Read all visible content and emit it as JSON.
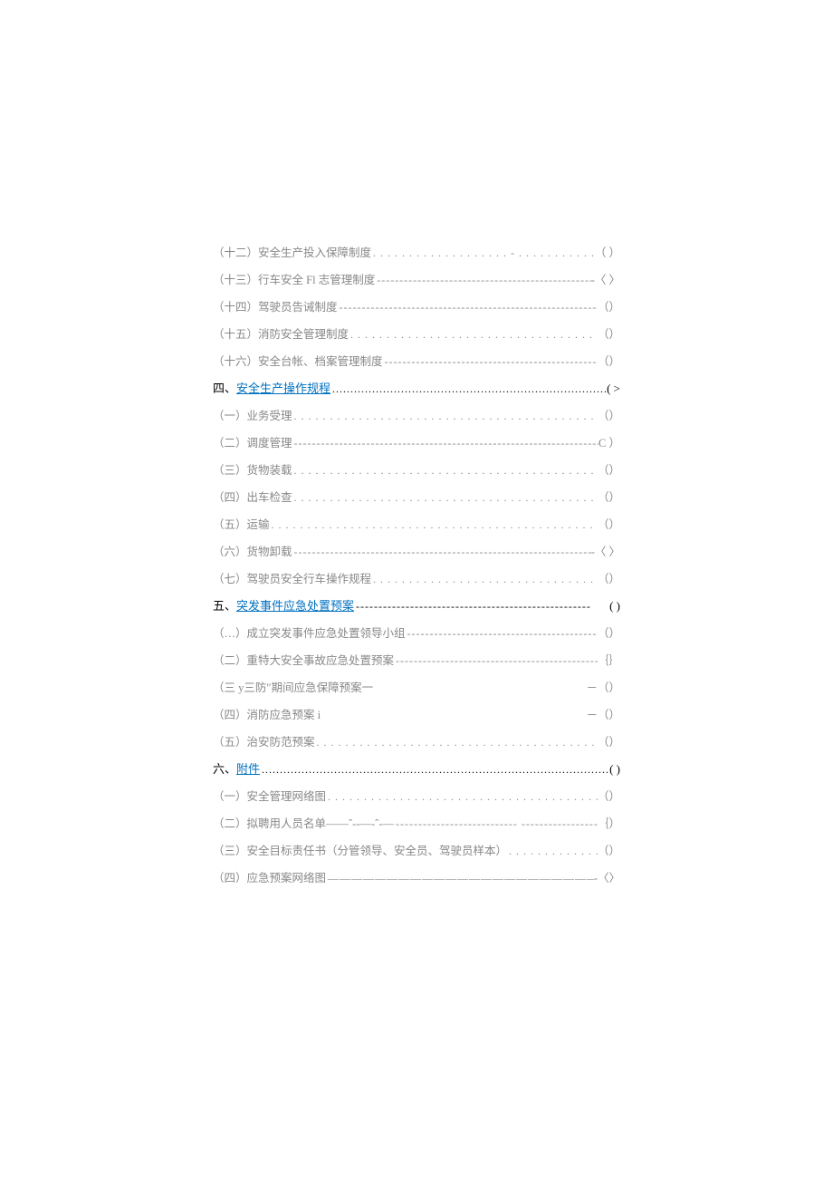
{
  "toc": [
    {
      "prefix": "（十二）",
      "text": "安全生产投入保障制度",
      "leader": ". . . . . . . . . . . . . . . . . . .  -  . . . . . . . . . . . . . . . . . . . . . ——",
      "page": "（ ）",
      "type": "sub"
    },
    {
      "prefix": "（十三）",
      "text": "行车安全 Fl 志管理制度",
      "leader": " ------------------------------------------------------------",
      "page": "-〈  〉",
      "type": "sub"
    },
    {
      "prefix": "（十四）",
      "text": "驾驶员告诫制度",
      "leader": " ---------------------------------------------------------------------- ",
      "page": "（）",
      "type": "sub"
    },
    {
      "prefix": "（十五）",
      "text": "消防安全管理制度 ",
      "leader": ". . . . . . . . . . . . . . . . . . . . . . . . . . . . . . . . . . . . . . . . . . . . . .",
      "page": "（）",
      "type": "sub"
    },
    {
      "prefix": "（十六）",
      "text": "安全台帐、档案管理制度 ",
      "leader": "-------------------------------------------------- ",
      "page": "（）",
      "type": "sub"
    },
    {
      "prefix": "四、",
      "text": "安全生产操作规程",
      "leader": "..........................................................................................................",
      "page": " ( >",
      "type": "header",
      "link": true
    },
    {
      "prefix": "（一）",
      "text": "业务受理 ",
      "leader": ". . . . . . . . . . . . . . . . . . . . . . . . . . . . . . . . . . . . . . . . . . . . . . . . . . . . . . ",
      "page": "（）",
      "type": "sub"
    },
    {
      "prefix": "（二）",
      "text": "调度管理 ",
      "leader": "----------------------------------------------------------------------------------",
      "page": "C  ）",
      "type": "sub"
    },
    {
      "prefix": "（三）",
      "text": "货物装载 ",
      "leader": ". . . . . . . . . . . . . . . . . . . . . . . . . . . . . . . . . . . . . . . . . . . . . . . . . . . . . . ",
      "page": "（）",
      "type": "sub"
    },
    {
      "prefix": "（四）",
      "text": "出车检查 ",
      "leader": ". . . . . . . . . . . . . . . . . . . . . . . . . . . . . . . . . . . . . . . . . . . . . . . . . . . . . . ",
      "page": "（）",
      "type": "sub"
    },
    {
      "prefix": "（五）",
      "text": "运输 ",
      "leader": ". . . . . . . . . . . . . . . . . . . . . . . . . . . . . . . . . . . . . . . . . . . . . . . . . . . . . . . . . . ",
      "page": "（）",
      "type": "sub"
    },
    {
      "prefix": "（六）",
      "text": "货物卸载 ",
      "leader": "----------------------------------------------------------------------------------",
      "page": "-〈  〉",
      "type": "sub"
    },
    {
      "prefix": "（七）",
      "text": "驾驶员安全行车操作规程 ",
      "leader": ". . . . . . . . . . . . . . . . . . . . . . . . . . . . . . . . . . . . . . . . ",
      "page": "（）",
      "type": "sub"
    },
    {
      "prefix": "五、",
      "text": "突发事件应急处置预案",
      "leader": " ----------------------------------------------------",
      "page": " ( )",
      "type": "header",
      "link": true
    },
    {
      "prefix": "（…）",
      "text": "成立突发事件应急处置领导小组 ",
      "leader": "------------------------------------------- ",
      "page": "（）",
      "type": "sub"
    },
    {
      "prefix": "（二）",
      "text": "重特大安全事故应急处置预案 ",
      "leader": "----------------------------------------------- ",
      "page": "｛｝",
      "type": "sub"
    },
    {
      "prefix": "（三 y",
      "text": " 三防″期间应急保障预案一",
      "leader": "                                                            ",
      "page": "－（）",
      "type": "sub"
    },
    {
      "prefix": "（四）",
      "text": "消防应急预案 i",
      "leader": "                                                                      ",
      "page": "－（）",
      "type": "sub"
    },
    {
      "prefix": "（五）",
      "text": "治安防范预案 ",
      "leader": ". . . . . . . . . . . . . . . . . . . . . . . . . . . . . . . . . . . . . . . . . . . . . . . . . ",
      "page": "（）",
      "type": "sub"
    },
    {
      "prefix": "六、",
      "text": "附件",
      "leader": "........................................................................................................................................",
      "page": " ( )",
      "type": "header",
      "link": true
    },
    {
      "prefix": "（一）",
      "text": "安全管理网络图 ",
      "leader": ". . . . . . . . . . . . . . . . . . . . . . . . . . . . . . . . . . . . . . . . . . . . . . . ",
      "page": "（）",
      "type": "sub"
    },
    {
      "prefix": "（二）",
      "text": "拟聘用人员名单——ˆ--—-ˆ-— ",
      "leader": "---------------------------   ------------------------------ ",
      "page": "｛）",
      "type": "sub"
    },
    {
      "prefix": "（三）",
      "text": "安全目标责任书（分管领导、安全员、驾驶员样本） ",
      "leader": ". . . . . . . . . . . . . . . . ",
      "page": "（）",
      "type": "sub"
    },
    {
      "prefix": "（四）",
      "text": "应急预案网络图 ",
      "leader": "—————————————————————————————",
      "page": "-〈〉",
      "type": "sub"
    }
  ]
}
